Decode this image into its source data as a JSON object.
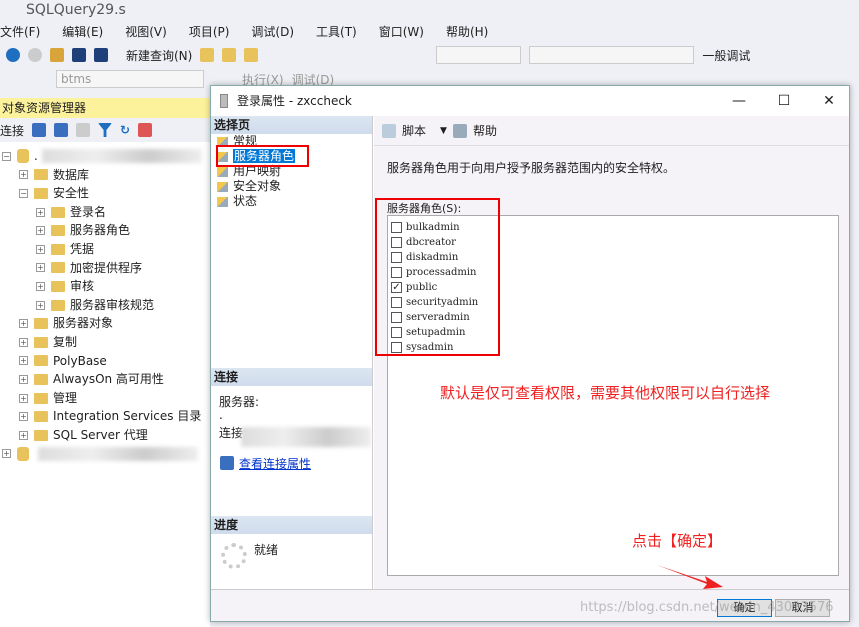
{
  "window": {
    "title": "SQLQuery29.s"
  },
  "menu": [
    "文件(F)",
    "编辑(E)",
    "视图(V)",
    "项目(P)",
    "调试(D)",
    "工具(T)",
    "窗口(W)",
    "帮助(H)"
  ],
  "toolbar": {
    "new_query": "新建查询(N)",
    "db_combo": "btms",
    "execute": "执行(X)",
    "debug": "调试(D)",
    "right_label": "一般调试"
  },
  "object_explorer": {
    "title": "对象资源管理器",
    "connect": "连接",
    "tree": [
      {
        "label": ".",
        "level": 0,
        "exp": "-"
      },
      {
        "label": "数据库",
        "level": 1,
        "exp": "+"
      },
      {
        "label": "安全性",
        "level": 1,
        "exp": "-"
      },
      {
        "label": "登录名",
        "level": 2,
        "exp": "+"
      },
      {
        "label": "服务器角色",
        "level": 2,
        "exp": "+"
      },
      {
        "label": "凭据",
        "level": 2,
        "exp": "+"
      },
      {
        "label": "加密提供程序",
        "level": 2,
        "exp": "+"
      },
      {
        "label": "审核",
        "level": 2,
        "exp": "+"
      },
      {
        "label": "服务器审核规范",
        "level": 2,
        "exp": "+"
      },
      {
        "label": "服务器对象",
        "level": 1,
        "exp": "+"
      },
      {
        "label": "复制",
        "level": 1,
        "exp": "+"
      },
      {
        "label": "PolyBase",
        "level": 1,
        "exp": "+"
      },
      {
        "label": "AlwaysOn 高可用性",
        "level": 1,
        "exp": "+"
      },
      {
        "label": "管理",
        "level": 1,
        "exp": "+"
      },
      {
        "label": "Integration Services 目录",
        "level": 1,
        "exp": "+"
      },
      {
        "label": "SQL Server 代理",
        "level": 1,
        "exp": "+"
      },
      {
        "label": "",
        "level": 0,
        "exp": "+"
      }
    ]
  },
  "dialog": {
    "title": "登录属性 - zxccheck",
    "select_page": "选择页",
    "pages": [
      "常规",
      "服务器角色",
      "用户映射",
      "安全对象",
      "状态"
    ],
    "selected_page": "服务器角色",
    "connection_header": "连接",
    "server_label": "服务器:",
    "server_value": ".",
    "connection_label": "连接:",
    "view_connection": "查看连接属性",
    "progress_header": "进度",
    "progress_status": "就绪",
    "script": "脚本",
    "help": "帮助",
    "description": "服务器角色用于向用户授予服务器范围内的安全特权。",
    "roles_label": "服务器角色(S):",
    "roles": [
      {
        "name": "bulkadmin",
        "checked": false
      },
      {
        "name": "dbcreator",
        "checked": false
      },
      {
        "name": "diskadmin",
        "checked": false
      },
      {
        "name": "processadmin",
        "checked": false
      },
      {
        "name": "public",
        "checked": true
      },
      {
        "name": "securityadmin",
        "checked": false
      },
      {
        "name": "serveradmin",
        "checked": false
      },
      {
        "name": "setupadmin",
        "checked": false
      },
      {
        "name": "sysadmin",
        "checked": false
      }
    ],
    "ok": "确定",
    "cancel": "取消"
  },
  "annotations": {
    "note1": "默认是仅可查看权限，需要其他权限可以自行选择",
    "note2": "点击【确定】",
    "watermark": "https://blog.csdn.net/weixin_43093576"
  },
  "colors": {
    "annotation": "#f02020",
    "selection": "#0078d7",
    "oe_header": "#fcf29c"
  }
}
